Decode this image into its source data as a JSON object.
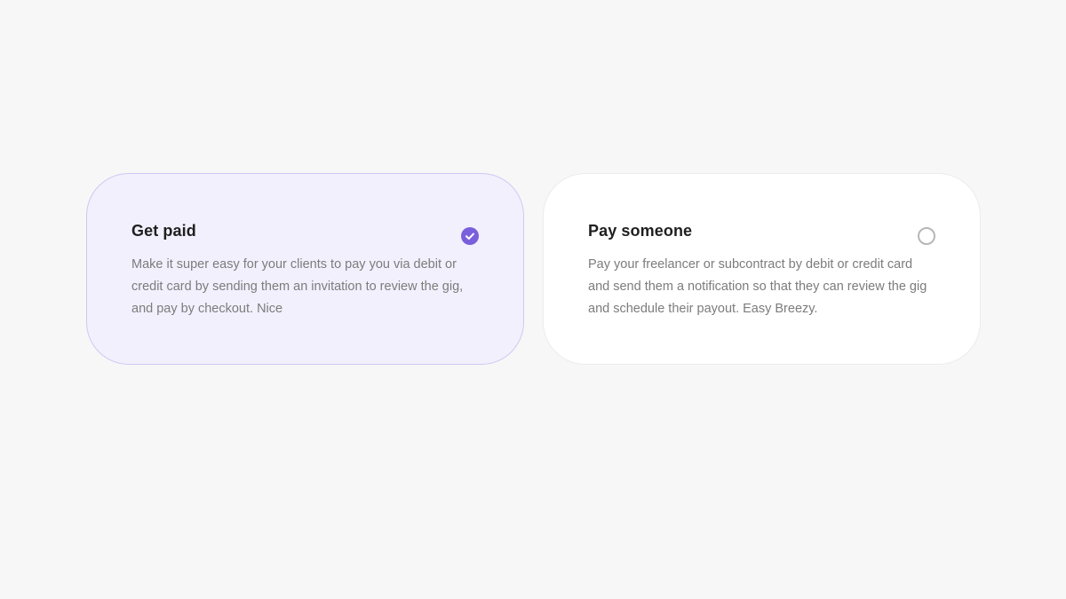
{
  "options": [
    {
      "title": "Get paid",
      "description": "Make it super easy for your clients to pay you via debit or credit card by sending them an invitation to review the gig, and pay by checkout. Nice",
      "selected": true
    },
    {
      "title": "Pay someone",
      "description": "Pay your freelancer or subcontract by debit or credit card and send them a notification so that they can review the gig and schedule their payout. Easy Breezy.",
      "selected": false
    }
  ],
  "colors": {
    "accent": "#7a5fdc",
    "selected_card_bg": "#f2f0fd",
    "selected_card_border": "#cfc8f2",
    "page_bg": "#f7f7f7"
  },
  "icons": {
    "checked": "check-icon",
    "unchecked": "radio-empty-icon"
  }
}
